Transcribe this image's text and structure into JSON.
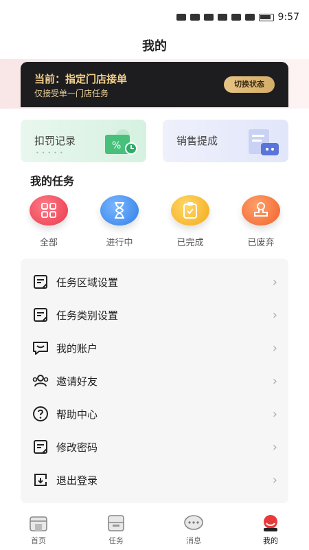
{
  "status_bar": {
    "time": "9:57"
  },
  "header": {
    "title": "我的"
  },
  "state_card": {
    "title": "当前：指定门店接单",
    "subtitle": "仅接受单一门店任务",
    "switch_label": "切换状态"
  },
  "quick_cards": {
    "penalty_label": "扣罚记录",
    "commission_label": "销售提成"
  },
  "my_tasks": {
    "title": "我的任务",
    "items": [
      {
        "label": "全部",
        "icon": "grid-icon",
        "color": "#ef4b5a"
      },
      {
        "label": "进行中",
        "icon": "hourglass-icon",
        "color": "#3c8ff0"
      },
      {
        "label": "已完成",
        "icon": "clipboard-check-icon",
        "color": "#f7b72a"
      },
      {
        "label": "已废弃",
        "icon": "stamp-icon",
        "color": "#f57437"
      }
    ]
  },
  "menu": {
    "items": [
      {
        "label": "任务区域设置",
        "icon": "note-icon"
      },
      {
        "label": "任务类别设置",
        "icon": "note-icon"
      },
      {
        "label": "我的账户",
        "icon": "message-icon"
      },
      {
        "label": "邀请好友",
        "icon": "users-icon"
      },
      {
        "label": "帮助中心",
        "icon": "question-icon"
      },
      {
        "label": "修改密码",
        "icon": "note-icon"
      },
      {
        "label": "退出登录",
        "icon": "logout-icon"
      }
    ]
  },
  "tab_bar": {
    "items": [
      {
        "label": "首页",
        "icon": "home-icon"
      },
      {
        "label": "任务",
        "icon": "task-icon"
      },
      {
        "label": "消息",
        "icon": "chat-icon"
      },
      {
        "label": "我的",
        "icon": "profile-icon",
        "active": true
      }
    ]
  }
}
